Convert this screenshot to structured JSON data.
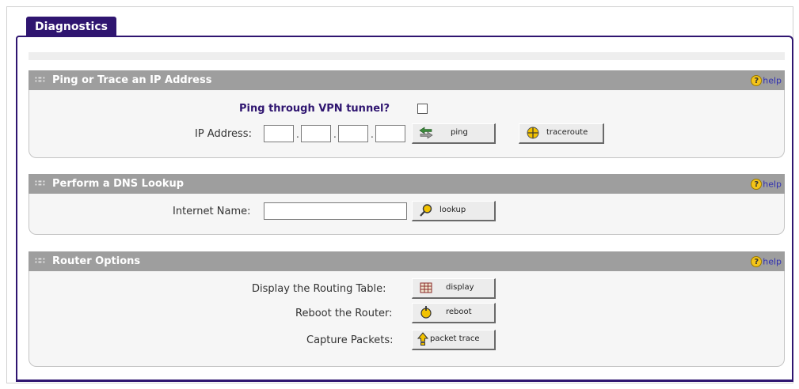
{
  "tab": {
    "label": "Diagnostics"
  },
  "sections": {
    "ping": {
      "title": "Ping or Trace an IP Address",
      "help": "help",
      "vpn_label": "Ping through VPN tunnel?",
      "ip_label": "IP Address:",
      "ping_button": "ping",
      "traceroute_button": "traceroute"
    },
    "dns": {
      "title": "Perform a DNS Lookup",
      "help": "help",
      "name_label": "Internet Name:",
      "lookup_button": "lookup"
    },
    "router": {
      "title": "Router Options",
      "help": "help",
      "routing_label": "Display the Routing Table:",
      "display_button": "display",
      "reboot_label": "Reboot the Router:",
      "reboot_button": "reboot",
      "capture_label": "Capture Packets:",
      "packet_button": "packet trace"
    }
  },
  "colors": {
    "accent": "#2f1570",
    "header_bg": "#9e9e9e",
    "body_bg": "#f6f6f6",
    "help_icon": "#f4c418"
  },
  "icons": {
    "help": "question-icon",
    "ping": "arrows-icon",
    "traceroute": "crosshair-icon",
    "lookup": "magnifier-icon",
    "display": "table-icon",
    "reboot": "restart-icon",
    "packet_trace": "upload-arrow-icon"
  }
}
